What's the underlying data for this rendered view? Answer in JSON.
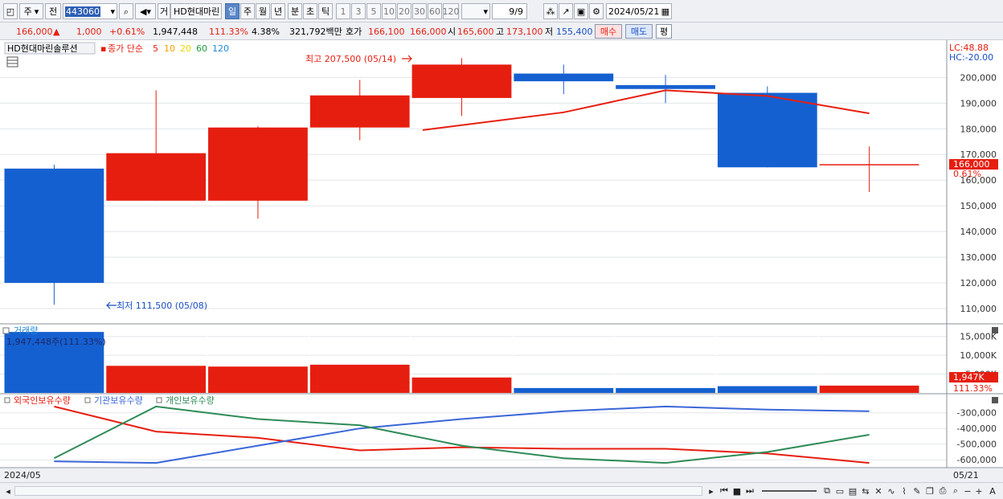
{
  "toolbar": {
    "market": "주",
    "market_sub": "전",
    "code": "443060",
    "name": "HD현대마린",
    "name_prefix": "거",
    "periods": [
      "일",
      "주",
      "월",
      "년",
      "분",
      "초",
      "틱"
    ],
    "active_period": "일",
    "intervals": [
      "1",
      "3",
      "5",
      "10",
      "20",
      "30",
      "60",
      "120"
    ],
    "page": "9/9",
    "date": "2024/05/21"
  },
  "quote": {
    "price": "166,000",
    "change_arrow": "▲",
    "change": "1,000",
    "change_pct": "+0.61%",
    "volume": "1,947,448",
    "volume_ratio": "111.33%",
    "turnover": "4.38%",
    "amount": "321,792백만",
    "bid_label": "호가",
    "bid": "166,100",
    "ask": "166,000",
    "open_label": "시",
    "open": "165,600",
    "high_label": "고",
    "high": "173,100",
    "low_label": "저",
    "low": "155,400",
    "buy_label": "매수",
    "sell_label": "매도",
    "avg_label": "평"
  },
  "price_panel": {
    "stock_label": "HD현대마린솔루션",
    "legend_title": "종가 단순",
    "ma": [
      {
        "label": "5",
        "color": "#e61e10"
      },
      {
        "label": "10",
        "color": "#f0a000"
      },
      {
        "label": "20",
        "color": "#e8d800"
      },
      {
        "label": "60",
        "color": "#1f9b3a"
      },
      {
        "label": "120",
        "color": "#1d8ad6"
      }
    ],
    "lc_label": "LC:48.88",
    "hc_label": "HC:-20.00",
    "high_annotation": "최고 207,500 (05/14)",
    "low_annotation": "최저 111,500 (05/08)",
    "current_price_tag": "166,000",
    "current_pct_tag": "0.61%",
    "y_ticks": [
      "200,000",
      "190,000",
      "180,000",
      "170,000",
      "160,000",
      "150,000",
      "140,000",
      "130,000",
      "120,000",
      "110,000"
    ]
  },
  "volume_panel": {
    "title": "거래량",
    "value_label": "1,947,448주(111.33%)",
    "y_ticks": [
      "15,000K",
      "10,000K",
      "5,000K"
    ],
    "current_tag": "1,947K",
    "current_pct": "111.33%"
  },
  "holdings_panel": {
    "series_labels": [
      {
        "label": "외국인보유수량",
        "color": "#e61e10"
      },
      {
        "label": "기관보유수량",
        "color": "#3a66d8"
      },
      {
        "label": "개인보유수량",
        "color": "#2e8b57"
      }
    ],
    "y_ticks": [
      "-300,000",
      "-400,000",
      "-500,000",
      "-600,000"
    ]
  },
  "x_axis": {
    "start_label": "2024/05",
    "end_label": "05/21"
  },
  "colors": {
    "up": "#e61e10",
    "down": "#1560d0",
    "ma5": "#e61e10"
  },
  "chart_data": {
    "type": "candlestick",
    "candles": [
      {
        "open": 164500,
        "high": 166000,
        "low": 111500,
        "close": 120000
      },
      {
        "open": 152000,
        "high": 195000,
        "low": 152000,
        "close": 170500
      },
      {
        "open": 152000,
        "high": 181000,
        "low": 145000,
        "close": 180500
      },
      {
        "open": 180500,
        "high": 199000,
        "low": 175500,
        "close": 193000
      },
      {
        "open": 192000,
        "high": 207500,
        "low": 185000,
        "close": 205000
      },
      {
        "open": 201500,
        "high": 205000,
        "low": 193500,
        "close": 198500
      },
      {
        "open": 197000,
        "high": 201000,
        "low": 190000,
        "close": 195500
      },
      {
        "open": 194000,
        "high": 196500,
        "low": 165000,
        "close": 165000
      },
      {
        "open": 165600,
        "high": 173100,
        "low": 155400,
        "close": 166000
      }
    ],
    "ma5": [
      null,
      null,
      null,
      null,
      179500,
      186400,
      195000,
      192800,
      186000
    ],
    "y_range": [
      105000,
      212000
    ],
    "volume_k": [
      16200,
      7200,
      7000,
      7500,
      4100,
      1300,
      1300,
      1800,
      1947
    ],
    "volume_range": [
      0,
      17500
    ],
    "foreign": [
      -260000,
      -420000,
      -460000,
      -540000,
      -520000,
      -530000,
      -530000,
      -560000,
      -620000
    ],
    "institution": [
      -610000,
      -620000,
      -510000,
      -400000,
      -340000,
      -290000,
      -260000,
      -280000,
      -290000
    ],
    "individual": [
      -590000,
      -260000,
      -340000,
      -380000,
      -510000,
      -590000,
      -620000,
      -550000,
      -440000
    ],
    "holdings_range": [
      -640000,
      -240000
    ]
  }
}
